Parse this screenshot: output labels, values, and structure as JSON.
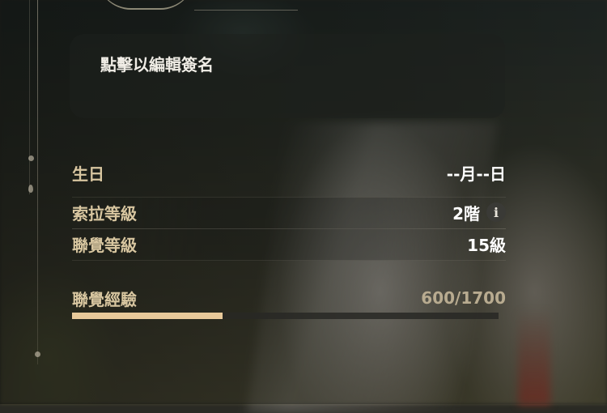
{
  "signature": {
    "placeholder": "點擊以編輯簽名"
  },
  "stats": [
    {
      "label": "生日",
      "value": "--月--日"
    },
    {
      "label": "索拉等級",
      "value": "2階",
      "has_info": true
    },
    {
      "label": "聯覺等級",
      "value": "15級"
    }
  ],
  "experience": {
    "label": "聯覺經驗",
    "value": "600/1700",
    "current": 600,
    "max": 1700,
    "fill_color": "#e8c99a"
  },
  "icons": {
    "info": "info-icon"
  },
  "colors": {
    "label": "#d8c6a0",
    "value": "#ffffff",
    "accent": "#e8c99a"
  }
}
